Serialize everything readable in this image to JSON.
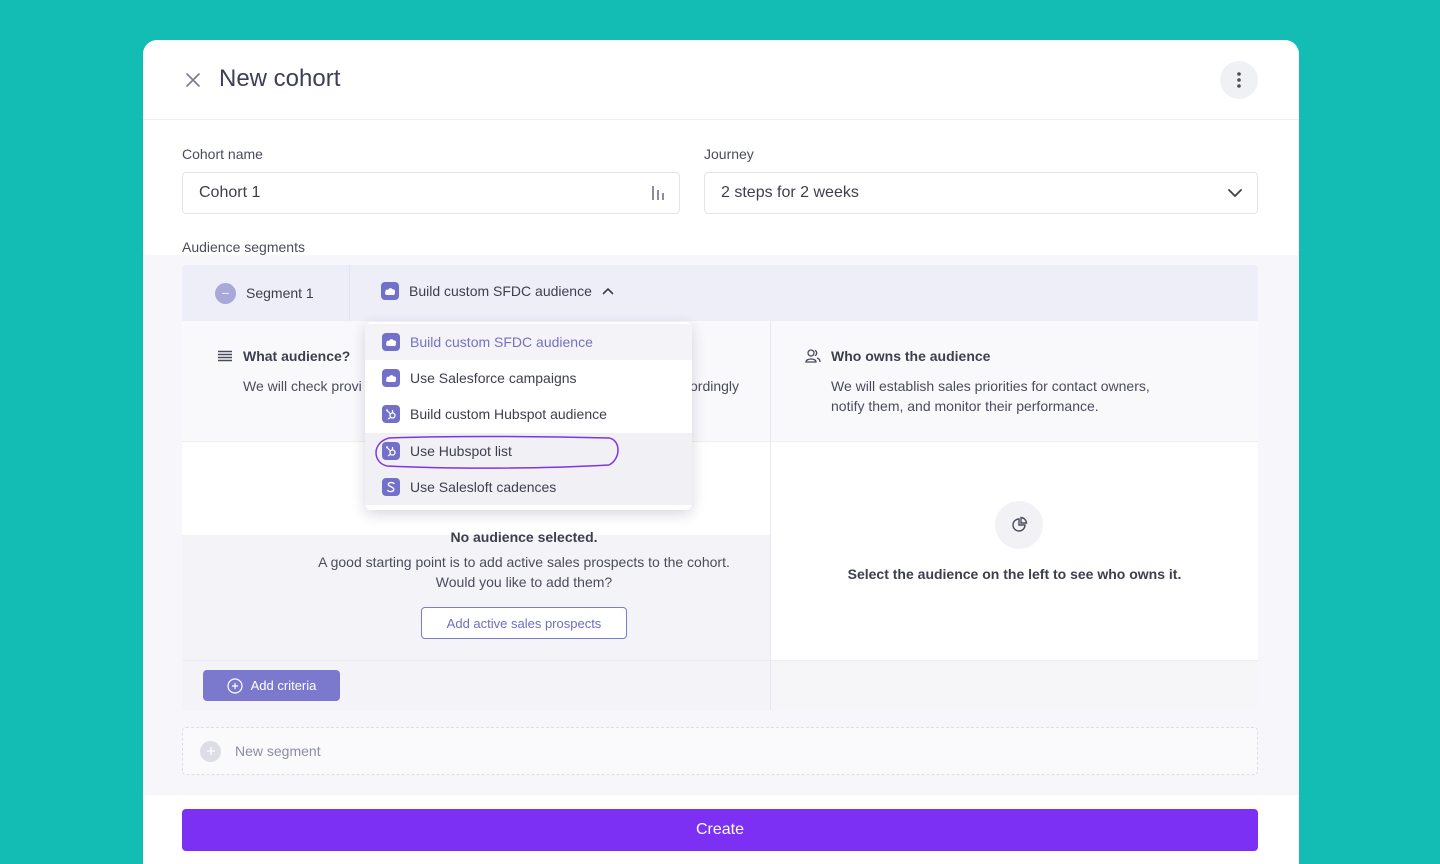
{
  "header": {
    "title": "New cohort"
  },
  "form": {
    "cohort_label": "Cohort name",
    "cohort_value": "Cohort 1",
    "journey_label": "Journey",
    "journey_value": "2 steps for 2 weeks",
    "segments_label": "Audience segments"
  },
  "segment": {
    "name": "Segment 1",
    "source": "Build custom SFDC audience"
  },
  "dropdown": {
    "items": [
      {
        "label": "Build custom SFDC audience",
        "icon": "salesforce-icon"
      },
      {
        "label": "Use Salesforce campaigns",
        "icon": "salesforce-icon"
      },
      {
        "label": "Build custom Hubspot audience",
        "icon": "hubspot-icon"
      },
      {
        "label": "Use Hubspot list",
        "icon": "hubspot-icon"
      },
      {
        "label": "Use Salesloft cadences",
        "icon": "salesloft-icon"
      }
    ]
  },
  "left_panel": {
    "title": "What audience?",
    "body_start": "We will check provi",
    "body_end": "ordingly",
    "empty_title": "No audience selected.",
    "empty_line1": "A good starting point is to add active sales prospects to the cohort.",
    "empty_line2": "Would you like to add them?",
    "add_prospects": "Add active sales prospects",
    "add_criteria": "Add criteria"
  },
  "right_panel": {
    "title": "Who owns the audience",
    "body_line1": "We will establish sales priorities for contact owners,",
    "body_line2": "notify them, and monitor their performance.",
    "empty_text": "Select the audience on the left to see who owns it."
  },
  "new_segment": "New segment",
  "create": "Create",
  "colors": {
    "background": "#14bdb3",
    "primary": "#7c30f3",
    "accent": "#7a79ce"
  }
}
